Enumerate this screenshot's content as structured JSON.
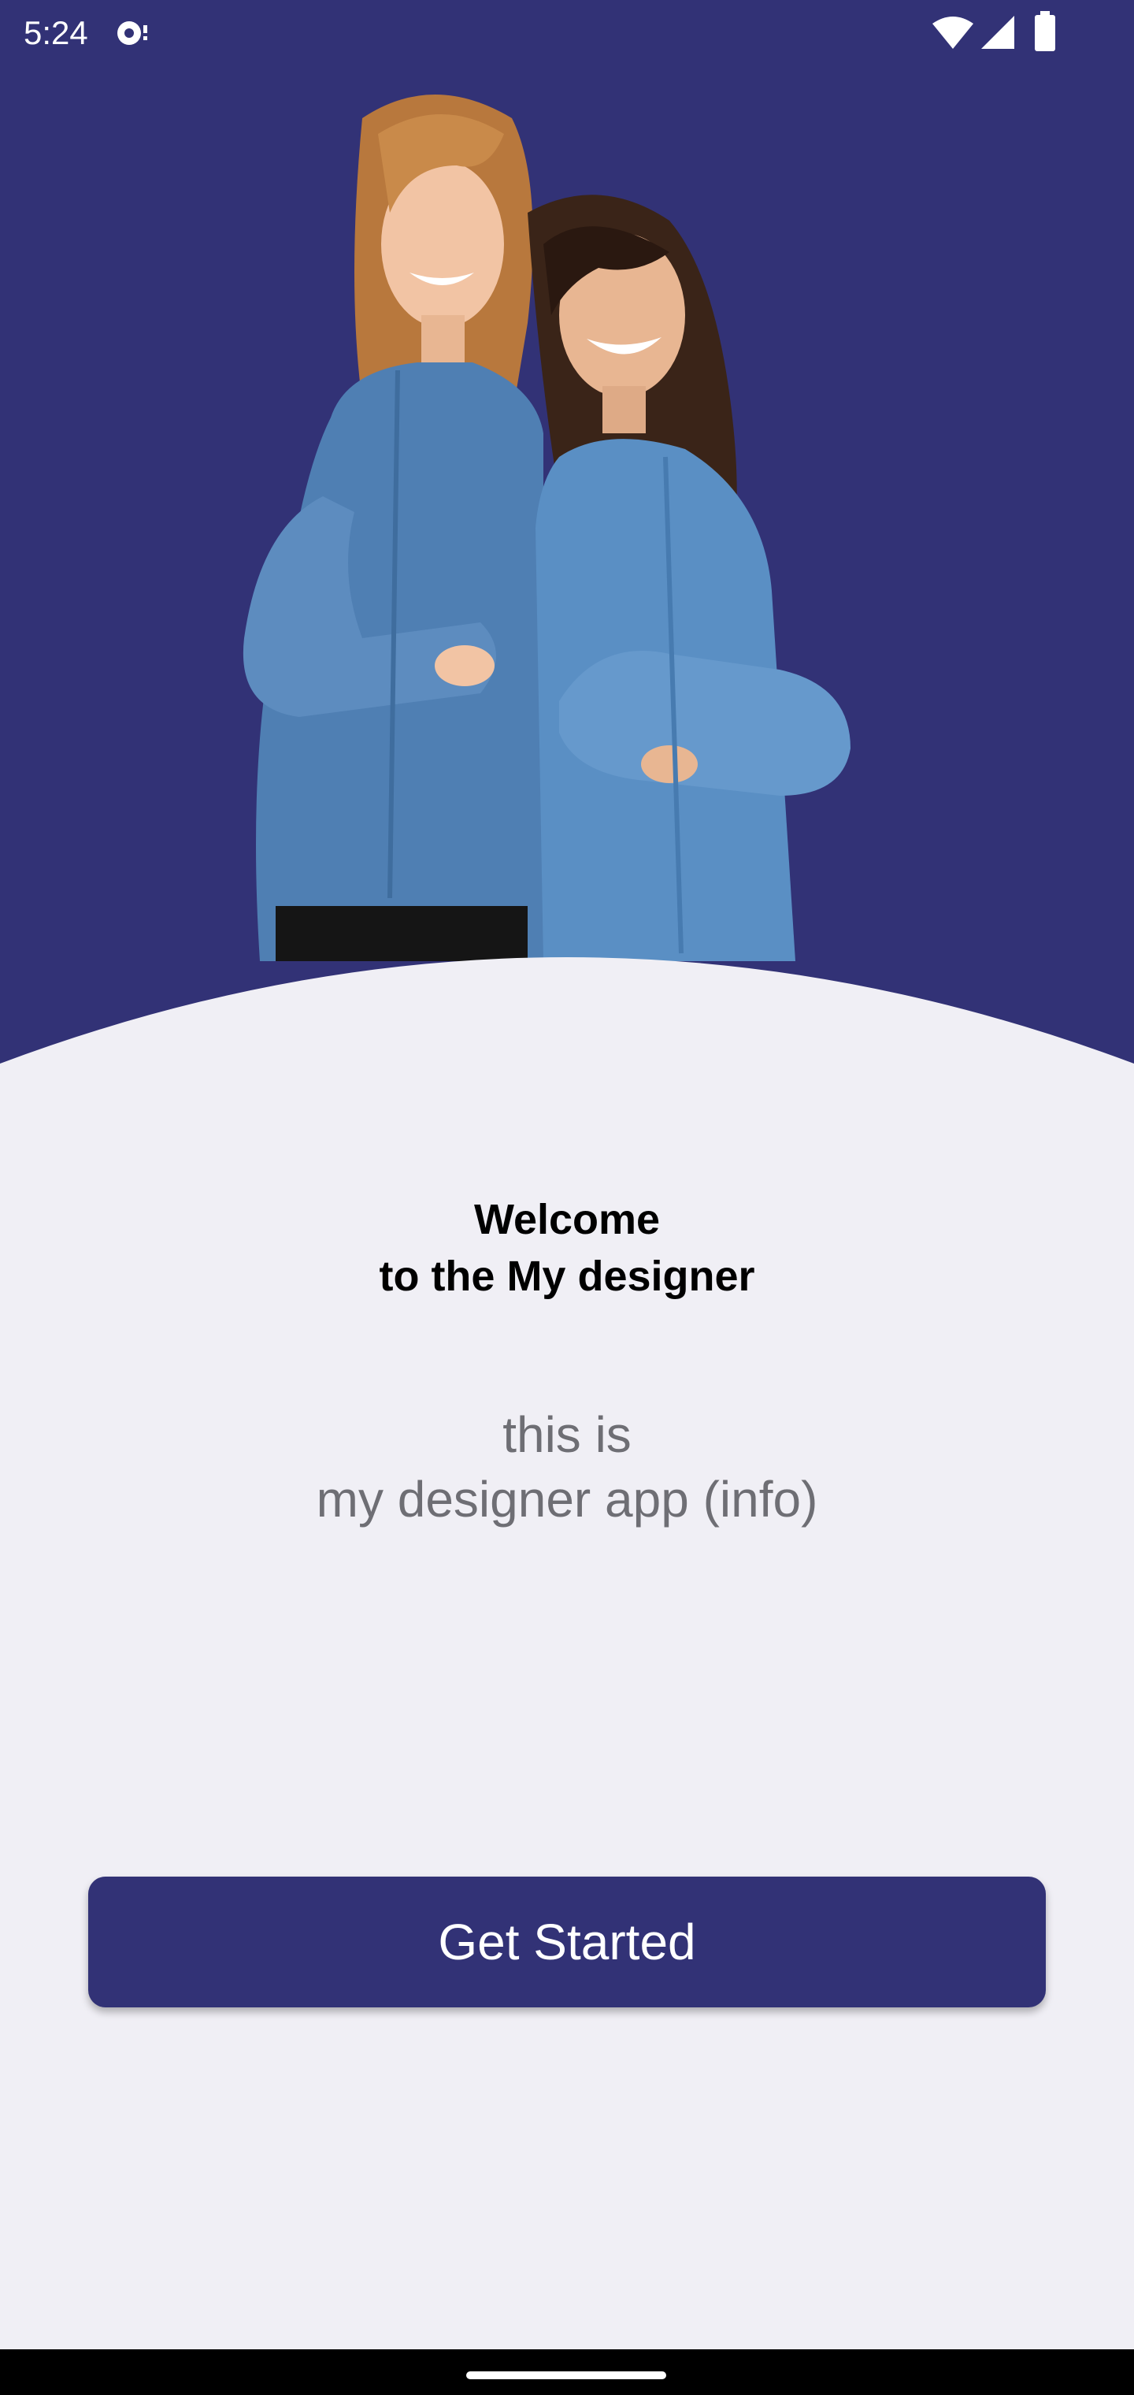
{
  "status_bar": {
    "time": "5:24",
    "icons": [
      "sync-notification-icon",
      "wifi-icon",
      "cellular-signal-icon",
      "battery-icon"
    ]
  },
  "hero": {
    "image": "two-women-denim-shirts-back-to-back-photo"
  },
  "welcome": {
    "line1": "Welcome",
    "line2": "to the My designer"
  },
  "info": {
    "line1": "this is",
    "line2": "my designer app (info)"
  },
  "cta": {
    "label": "Get Started"
  },
  "colors": {
    "primary": "#323276",
    "background": "#f0eff5",
    "info_text": "#6e6e74"
  }
}
